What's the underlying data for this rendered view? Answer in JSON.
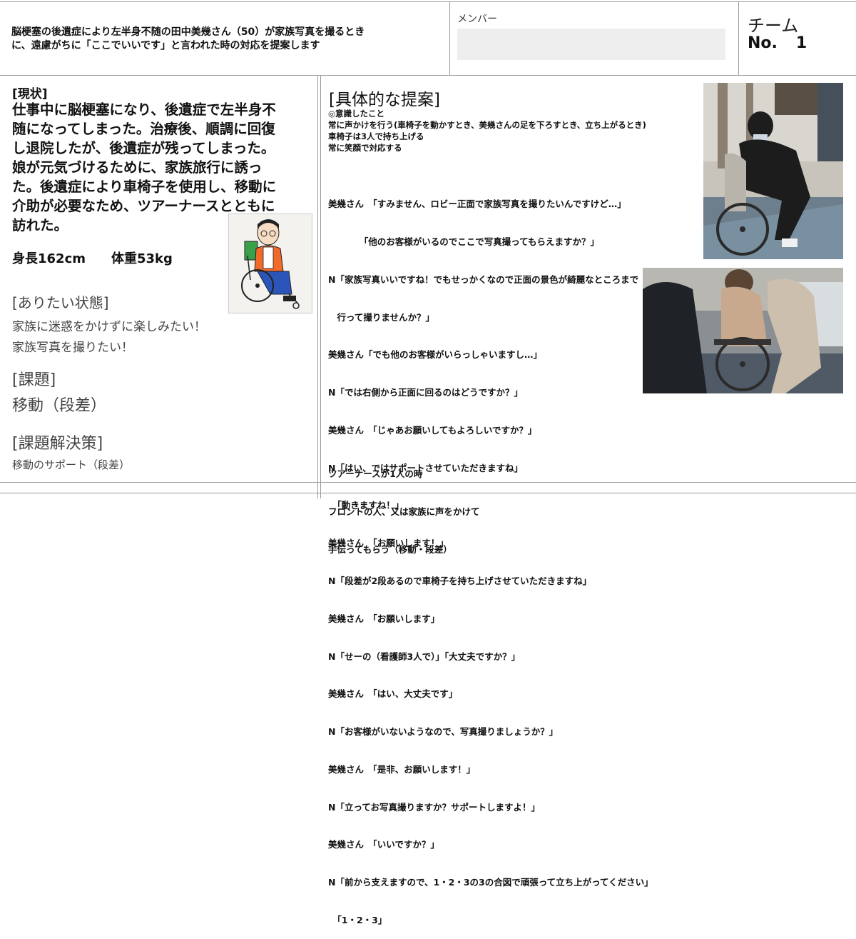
{
  "header": {
    "title_line1": "脳梗塞の後遺症により左半身不随の田中美幾さん（50）が家族写真を撮るとき",
    "title_line2": "に、遠慮がちに「ここでいいです」と言われた時の対応を提案します",
    "member_label": "メンバー",
    "team_label": "チーム",
    "team_no_label": "No.",
    "team_no_value": "1"
  },
  "left": {
    "status_heading": "[現状]",
    "status_lines": [
      "仕事中に脳梗塞になり、後遺症で左半身不",
      "随になってしまった。治療後、順調に回復",
      "し退院したが、後遺症が残ってしまった。",
      "娘が元気づけるために、家族旅行に誘っ",
      "た。後遺症により車椅子を使用し、移動に",
      "介助が必要なため、ツアーナースとともに",
      "訪れた。"
    ],
    "height": "身長162cm",
    "weight": "体重53kg",
    "ideal_heading": "[ありたい状態]",
    "ideal_lines": [
      "家族に迷惑をかけずに楽しみたい！",
      "家族写真を撮りたい！"
    ],
    "issue_heading": "[課題]",
    "issue_body": "移動（段差）",
    "solution_heading": "[課題解決策]",
    "solution_body": "移動のサポート（段差）"
  },
  "proposal": {
    "heading": "[具体的な提案]",
    "notes": [
      "◎意識したこと",
      "常に声かけを行う(車椅子を動かすとき、美幾さんの足を下ろすとき、立ち上がるとき)",
      "車椅子は3人で持ち上げる",
      "常に笑顔で対応する"
    ],
    "dialogue": [
      "美幾さん　「すみません、ロビー正面で家族写真を撮りたいんですけど…」",
      "　　　　「他のお客様がいるのでここで写真撮ってもらえますか？」",
      "N「家族写真いいですね！でもせっかくなので正面の景色が綺麗なところまで",
      "　行って撮りませんか？」",
      "美幾さん「でも他のお客様がいらっしゃいますし…」",
      "N「では右側から正面に回るのはどうですか？」",
      "美幾さん　「じゃあお願いしてもよろしいですか？」",
      "N「はい、ではサポートさせていただきますね」",
      "　「動きますね！」",
      "美幾さん　「お願いします！」",
      "N「段差が2段あるので車椅子を持ち上げさせていただきますね」",
      "美幾さん　「お願いします」",
      "N「せーの（看護師3人で）」「大丈夫ですか？」",
      "美幾さん　「はい、大丈夫です」",
      "N「お客様がいないようなので、写真撮りましょうか？」",
      "美幾さん　「是非、お願いします！」",
      "N「立ってお写真撮りますか？サポートしますよ！」",
      "美幾さん　「いいですか？」",
      "N「前から支えますので、1・2・3の3の合図で頑張って立ち上がってください」",
      "　「1・2・3」"
    ],
    "footer_lines": [
      "ツアーナースが1人の時",
      "フロントの人、又は家族に声をかけて",
      "手伝ってもらう（移動・段差）"
    ]
  },
  "colors": {
    "grid_line": "#9a9a9a",
    "member_box": "#eeeeee"
  }
}
